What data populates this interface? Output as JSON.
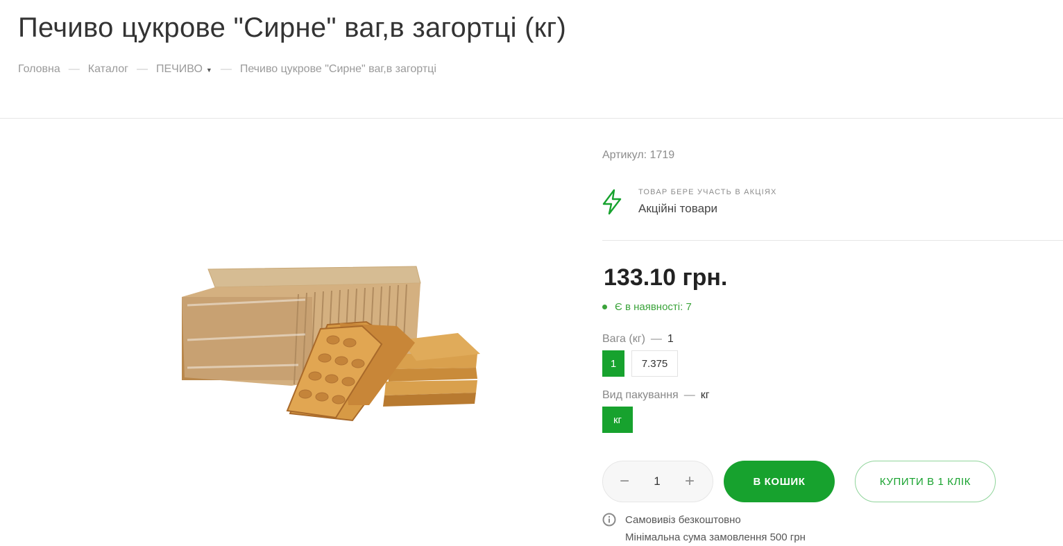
{
  "product": {
    "title": "Печиво цукрове \"Сирне\" ваг,в загортці (кг)",
    "article": "Артикул: 1719",
    "price": "133.10 грн.",
    "stock": "Є в наявності: 7"
  },
  "breadcrumb": {
    "home": "Головна",
    "catalog": "Каталог",
    "category": "ПЕЧИВО",
    "current": "Печиво цукрове \"Сирне\" ваг,в загортці",
    "separator": "—"
  },
  "promo": {
    "caption": "ТОВАР БЕРЕ УЧАСТЬ В АКЦІЯХ",
    "name": "Акційні товари",
    "icon": "lightning-icon"
  },
  "options": {
    "weight": {
      "label": "Вага (кг)",
      "dash": "—",
      "selected": "1",
      "values": [
        "1",
        "7.375"
      ]
    },
    "packaging": {
      "label": "Вид пакування",
      "dash": "—",
      "selected": "кг",
      "values": [
        "кг"
      ]
    }
  },
  "purchase": {
    "quantity": "1",
    "minus": "−",
    "plus": "+",
    "add_to_cart": "В КОШИК",
    "buy_one_click": "КУПИТИ В 1 КЛІК"
  },
  "delivery": {
    "line1": "Самовивіз безкоштовно",
    "line2": "Мінімальна сума замовлення 500 грн",
    "icon": "info-icon"
  },
  "colors": {
    "accent": "#17a22e",
    "stock": "#3aa33a",
    "text": "#333333",
    "muted": "#9a9a9a"
  }
}
